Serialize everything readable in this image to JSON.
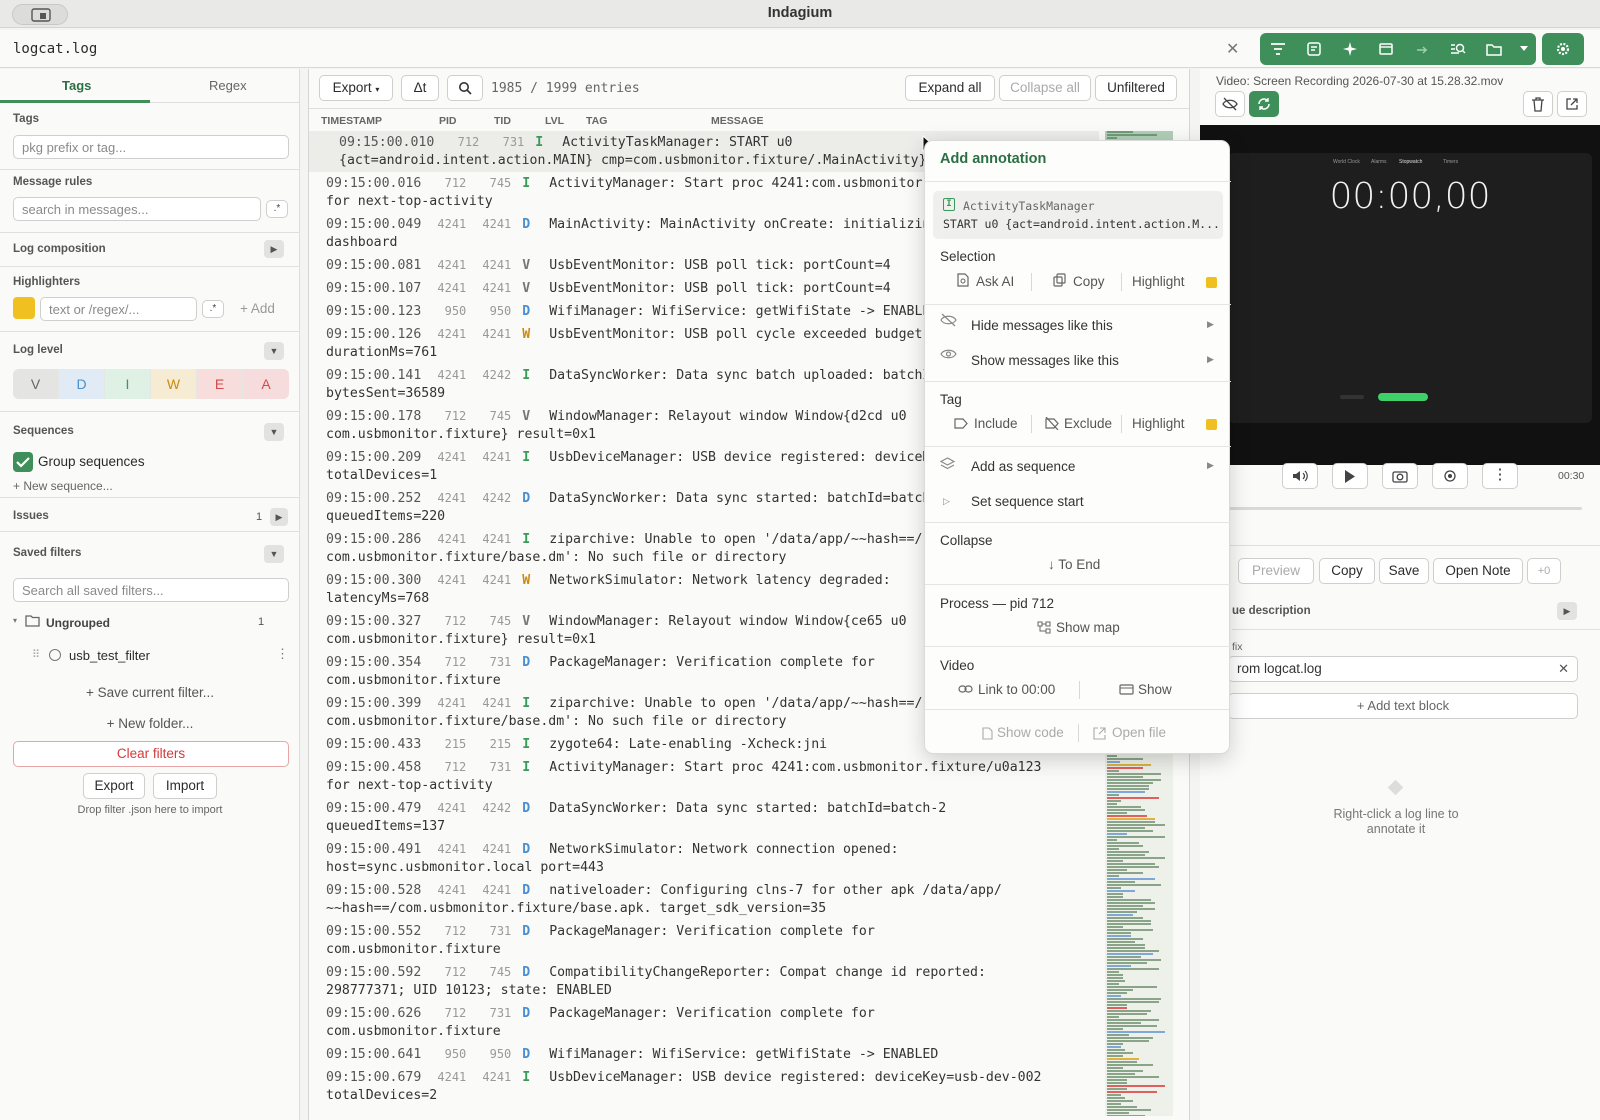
{
  "app": {
    "title": "Indagium"
  },
  "file": {
    "name": "logcat.log"
  },
  "left": {
    "tabs": [
      "Tags",
      "Regex"
    ],
    "tags_label": "Tags",
    "tags_placeholder": "pkg prefix or tag...",
    "rules_label": "Message rules",
    "rules_placeholder": "search in messages...",
    "composition_label": "Log composition",
    "highlighters_label": "Highlighters",
    "hl_placeholder": "text or /regex/...",
    "hl_add": "+ Add",
    "loglevel_label": "Log level",
    "levels": [
      "V",
      "D",
      "I",
      "W",
      "E",
      "A"
    ],
    "sequences_label": "Sequences",
    "group_seq": "Group sequences",
    "new_seq": "+ New sequence...",
    "issues_label": "Issues",
    "issues_count": "1",
    "saved_label": "Saved filters",
    "saved_placeholder": "Search all saved filters...",
    "folder": "Ungrouped",
    "folder_count": "1",
    "filter_item": "usb_test_filter",
    "save_current": "+ Save current filter...",
    "new_folder": "+ New folder...",
    "clear": "Clear filters",
    "export": "Export",
    "import": "Import",
    "drop": "Drop filter .json here to import"
  },
  "log": {
    "export": "Export",
    "delta": "Δt",
    "entries": "1985 / 1999 entries",
    "expand": "Expand all",
    "collapse": "Collapse all",
    "unfiltered": "Unfiltered",
    "cols": [
      "TIMESTAMP",
      "PID",
      "TID",
      "LVL",
      "TAG",
      "MESSAGE"
    ],
    "rows": [
      {
        "t": "09:15:00.010",
        "p": "712",
        "d": "731",
        "l": "I",
        "m": "ActivityTaskManager: START u0",
        "m2": "{act=android.intent.action.MAIN} cmp=com.usbmonitor.fixture/.MainActivity}"
      },
      {
        "t": "09:15:00.016",
        "p": "712",
        "d": "745",
        "l": "I",
        "m": "ActivityManager: Start proc 4241:com.usbmonitor.fixture/u0a123",
        "m2": "for next-top-activity"
      },
      {
        "t": "09:15:00.049",
        "p": "4241",
        "d": "4241",
        "l": "D",
        "m": "MainActivity: MainActivity onCreate: initializing",
        "m2": "dashboard"
      },
      {
        "t": "09:15:00.081",
        "p": "4241",
        "d": "4241",
        "l": "V",
        "m": "UsbEventMonitor: USB poll tick: portCount=4",
        "m2": ""
      },
      {
        "t": "09:15:00.107",
        "p": "4241",
        "d": "4241",
        "l": "V",
        "m": "UsbEventMonitor: USB poll tick: portCount=4",
        "m2": ""
      },
      {
        "t": "09:15:00.123",
        "p": "950",
        "d": "950",
        "l": "D",
        "m": "WifiManager: WifiService: getWifiState -> ENABLED",
        "m2": ""
      },
      {
        "t": "09:15:00.126",
        "p": "4241",
        "d": "4241",
        "l": "W",
        "m": "UsbEventMonitor: USB poll cycle exceeded budget:",
        "m2": "durationMs=761"
      },
      {
        "t": "09:15:00.141",
        "p": "4241",
        "d": "4242",
        "l": "I",
        "m": "DataSyncWorker: Data sync batch uploaded: batchId=batch-1",
        "m2": "bytesSent=36589"
      },
      {
        "t": "09:15:00.178",
        "p": "712",
        "d": "745",
        "l": "V",
        "m": "WindowManager: Relayout window Window{d2cd u0",
        "m2": "com.usbmonitor.fixture} result=0x1"
      },
      {
        "t": "09:15:00.209",
        "p": "4241",
        "d": "4241",
        "l": "I",
        "m": "UsbDeviceManager: USB device registered: deviceKey=usb-dev-001",
        "m2": "totalDevices=1"
      },
      {
        "t": "09:15:00.252",
        "p": "4241",
        "d": "4242",
        "l": "D",
        "m": "DataSyncWorker: Data sync started: batchId=batch-1",
        "m2": "queuedItems=220"
      },
      {
        "t": "09:15:00.286",
        "p": "4241",
        "d": "4241",
        "l": "I",
        "m": "ziparchive: Unable to open '/data/app/~~hash==/",
        "m2": "com.usbmonitor.fixture/base.dm': No such file or directory"
      },
      {
        "t": "09:15:00.300",
        "p": "4241",
        "d": "4241",
        "l": "W",
        "m": "NetworkSimulator: Network latency degraded:",
        "m2": "latencyMs=768"
      },
      {
        "t": "09:15:00.327",
        "p": "712",
        "d": "745",
        "l": "V",
        "m": "WindowManager: Relayout window Window{ce65 u0",
        "m2": "com.usbmonitor.fixture} result=0x1"
      },
      {
        "t": "09:15:00.354",
        "p": "712",
        "d": "731",
        "l": "D",
        "m": "PackageManager: Verification complete for",
        "m2": "com.usbmonitor.fixture"
      },
      {
        "t": "09:15:00.399",
        "p": "4241",
        "d": "4241",
        "l": "I",
        "m": "ziparchive: Unable to open '/data/app/~~hash==/",
        "m2": "com.usbmonitor.fixture/base.dm': No such file or directory"
      },
      {
        "t": "09:15:00.433",
        "p": "215",
        "d": "215",
        "l": "I",
        "m": "zygote64: Late-enabling -Xcheck:jni",
        "m2": ""
      },
      {
        "t": "09:15:00.458",
        "p": "712",
        "d": "731",
        "l": "I",
        "m": "ActivityManager: Start proc 4241:com.usbmonitor.fixture/u0a123",
        "m2": "for next-top-activity"
      },
      {
        "t": "09:15:00.479",
        "p": "4241",
        "d": "4242",
        "l": "D",
        "m": "DataSyncWorker: Data sync started: batchId=batch-2",
        "m2": "queuedItems=137"
      },
      {
        "t": "09:15:00.491",
        "p": "4241",
        "d": "4241",
        "l": "D",
        "m": "NetworkSimulator: Network connection opened:",
        "m2": "host=sync.usbmonitor.local port=443"
      },
      {
        "t": "09:15:00.528",
        "p": "4241",
        "d": "4241",
        "l": "D",
        "m": "nativeloader: Configuring clns-7 for other apk /data/app/",
        "m2": "~~hash==/com.usbmonitor.fixture/base.apk. target_sdk_version=35"
      },
      {
        "t": "09:15:00.552",
        "p": "712",
        "d": "731",
        "l": "D",
        "m": "PackageManager: Verification complete for",
        "m2": "com.usbmonitor.fixture"
      },
      {
        "t": "09:15:00.592",
        "p": "712",
        "d": "745",
        "l": "D",
        "m": "CompatibilityChangeReporter: Compat change id reported:",
        "m2": "298777371; UID 10123; state: ENABLED"
      },
      {
        "t": "09:15:00.626",
        "p": "712",
        "d": "731",
        "l": "D",
        "m": "PackageManager: Verification complete for",
        "m2": "com.usbmonitor.fixture"
      },
      {
        "t": "09:15:00.641",
        "p": "950",
        "d": "950",
        "l": "D",
        "m": "WifiManager: WifiService: getWifiState -> ENABLED",
        "m2": ""
      },
      {
        "t": "09:15:00.679",
        "p": "4241",
        "d": "4241",
        "l": "I",
        "m": "UsbDeviceManager: USB device registered: deviceKey=usb-dev-002",
        "m2": "totalDevices=2"
      }
    ]
  },
  "video": {
    "title": "Video: Screen Recording 2026-07-30 at 15.28.32.mov",
    "clock": "00:00,00",
    "tabs": [
      "World Clock",
      "Alarms",
      "Stopwatch",
      "Timers"
    ],
    "t_start": "00",
    "t_end": "00:30"
  },
  "note": {
    "preview": "Preview",
    "copy": "Copy",
    "save": "Save",
    "open": "Open Note",
    "count": "+0",
    "desc": "ue description",
    "prefix_label": "fix",
    "prefix_value": "rom logcat.log",
    "add_block": "+ Add text block",
    "empty": "Right-click a log line to annotate it"
  },
  "menu": {
    "title": "Add annotation",
    "ctx_tag": "ActivityTaskManager",
    "ctx_msg": "START u0 {act=android.intent.action.M...",
    "ctx_lvl": "I",
    "selection": "Selection",
    "ask": "Ask AI",
    "copy": "Copy",
    "highlight": "Highlight",
    "hide": "Hide messages like this",
    "show": "Show messages like this",
    "tag": "Tag",
    "include": "Include",
    "exclude": "Exclude",
    "tag_highlight": "Highlight",
    "add_seq": "Add as sequence",
    "set_seq": "Set sequence start",
    "collapse": "Collapse",
    "to_end": "To End",
    "process": "Process — pid 712",
    "show_map": "Show map",
    "video": "Video",
    "link": "Link to 00:00",
    "vshow": "Show",
    "show_code": "Show code",
    "open_file": "Open file",
    "accent": "#f0c020"
  }
}
